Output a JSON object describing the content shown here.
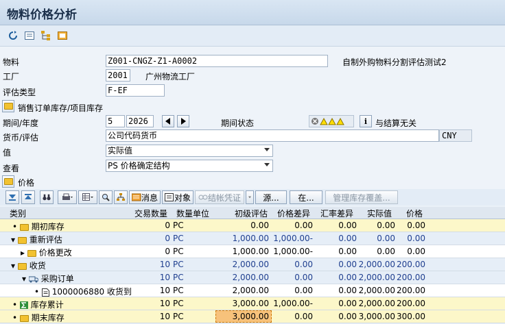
{
  "title": "物料价格分析",
  "toolbar": {
    "icons": [
      "refresh-icon",
      "list-icon",
      "hierarchy-icon",
      "export-icon"
    ]
  },
  "form": {
    "material_label": "物料",
    "material_value": "Z001-CNGZ-Z1-A0002",
    "material_desc": "自制外购物料分割评估测试2",
    "plant_label": "工厂",
    "plant_value": "2001",
    "plant_desc": "广州物流工厂",
    "valtype_label": "评估类型",
    "valtype_value": "F-EF",
    "sales_stock_label": "销售订单库存/项目库存",
    "period_label": "期间/年度",
    "period_value": "5",
    "year_value": "2026",
    "period_status_label": "期间状态",
    "period_status_text": "与结算无关",
    "currency_label": "货币/评估",
    "currency_value": "公司代码货币",
    "currency_code": "CNY",
    "value_label": "值",
    "value_value": "实际值",
    "view_label": "查看",
    "view_value": "PS 价格确定结构",
    "price_label": "价格"
  },
  "grid_toolbar": {
    "msg_btn": "消息",
    "obj_btn": "对象",
    "doc_btn": "结帐凭证",
    "src_btn": "源...",
    "in_btn": "在...",
    "manage_btn": "管理库存覆盖..."
  },
  "table": {
    "headers": [
      "类别",
      "交易数量",
      "数量单位",
      "初级评估",
      "价格差异",
      "汇率差异",
      "实际值",
      "价格"
    ],
    "rows": [
      {
        "label": "期初库存",
        "qty": "0",
        "unit": "PC",
        "prim": "0.00",
        "diff": "0.00",
        "fx": "0.00",
        "actual": "0.00",
        "price": "0.00"
      },
      {
        "label": "重新评估",
        "qty": "0",
        "unit": "PC",
        "prim": "1,000.00",
        "diff": "1,000.00-",
        "fx": "0.00",
        "actual": "0.00",
        "price": "0.00"
      },
      {
        "label": "价格更改",
        "qty": "0",
        "unit": "PC",
        "prim": "1,000.00",
        "diff": "1,000.00-",
        "fx": "0.00",
        "actual": "0.00",
        "price": "0.00"
      },
      {
        "label": "收货",
        "qty": "10",
        "unit": "PC",
        "prim": "2,000.00",
        "diff": "0.00",
        "fx": "0.00",
        "actual": "2,000.00",
        "price": "200.00"
      },
      {
        "label": "采购订单",
        "qty": "10",
        "unit": "PC",
        "prim": "2,000.00",
        "diff": "0.00",
        "fx": "0.00",
        "actual": "2,000.00",
        "price": "200.00"
      },
      {
        "label": "1000006880 收货到",
        "qty": "10",
        "unit": "PC",
        "prim": "2,000.00",
        "diff": "0.00",
        "fx": "0.00",
        "actual": "2,000.00",
        "price": "200.00"
      },
      {
        "label": "库存累计",
        "qty": "10",
        "unit": "PC",
        "prim": "3,000.00",
        "diff": "1,000.00-",
        "fx": "0.00",
        "actual": "2,000.00",
        "price": "200.00"
      },
      {
        "label": "期末库存",
        "qty": "10",
        "unit": "PC",
        "prim": "3,000.00",
        "diff": "0.00",
        "fx": "0.00",
        "actual": "3,000.00",
        "price": "300.00"
      }
    ]
  }
}
